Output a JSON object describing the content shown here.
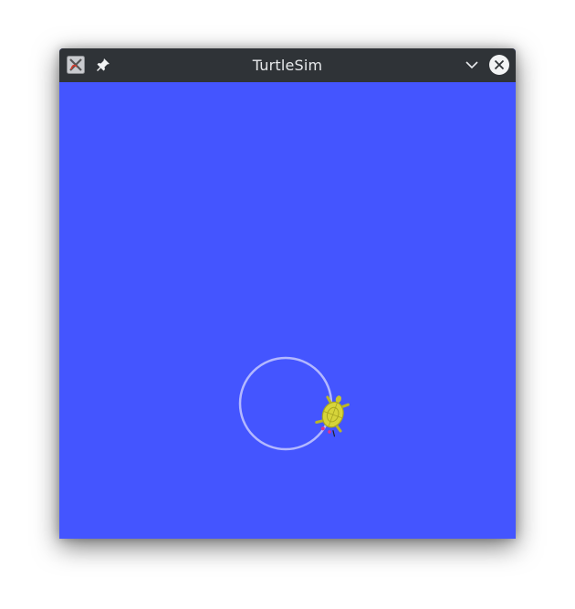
{
  "window": {
    "title": "TurtleSim"
  },
  "icons": {
    "app": "turtlesim-app-icon",
    "pin": "pin-icon",
    "minimize": "chevron-down-icon",
    "close": "close-icon"
  },
  "colors": {
    "titlebar": "#2f3337",
    "background": "#4455ff",
    "pen": "#b3b8ff",
    "turtle": "#d6d43a"
  }
}
